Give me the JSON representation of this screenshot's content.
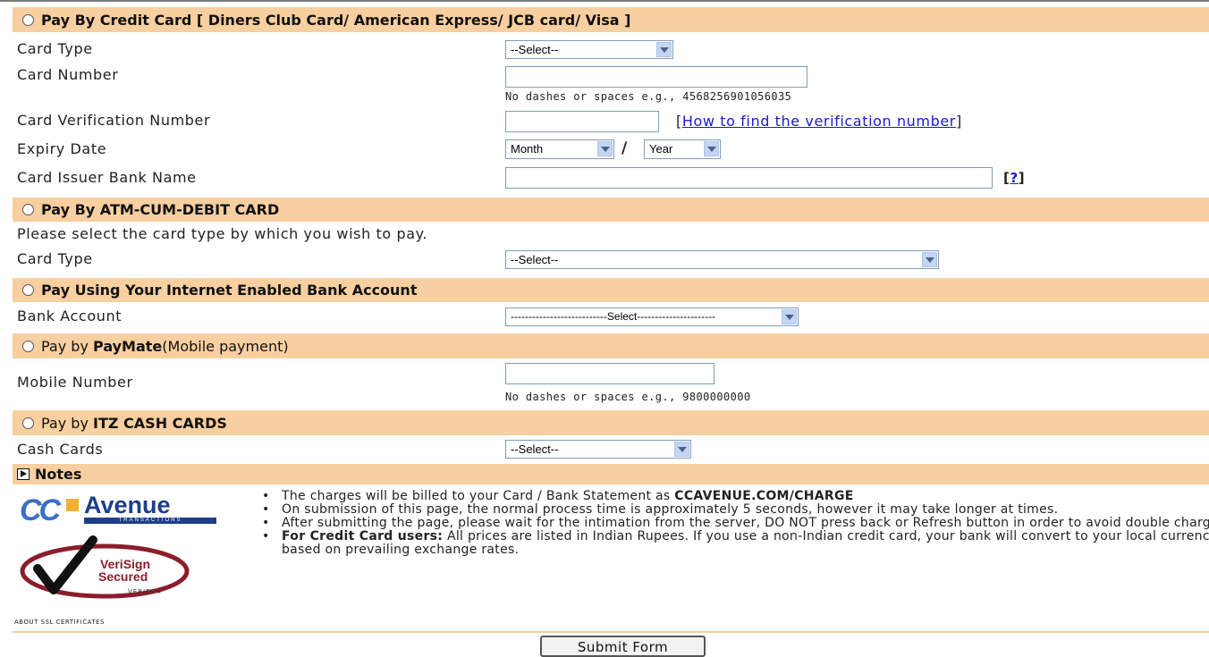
{
  "credit": {
    "label_pre": "Pay By Credit Card",
    "label_cards": "[ Diners Club Card/ American Express/ JCB card/ Visa ]",
    "card_type_label": "Card Type",
    "card_type_value": "--Select--",
    "card_number_label": "Card Number",
    "card_number_hint": "No dashes or spaces e.g., 4568256901056035",
    "cvv_label": "Card Verification Number",
    "cvv_link_open": "[",
    "cvv_link": "How to find the verification number",
    "cvv_link_close": "]",
    "expiry_label": "Expiry Date",
    "month_value": "Month",
    "slash": "/",
    "year_value": "Year",
    "issuer_label": "Card Issuer Bank Name",
    "issuer_help_open": "[",
    "issuer_help": "?",
    "issuer_help_close": "]"
  },
  "debit": {
    "label": "Pay By ATM-CUM-DEBIT CARD",
    "instruction": "Please select the card type by which you wish to pay.",
    "card_type_label": "Card Type",
    "card_type_value": "--Select--"
  },
  "netbank": {
    "label": "Pay Using Your Internet Enabled Bank Account",
    "account_label": "Bank Account",
    "account_value": "---------------------------Select----------------------"
  },
  "paymate": {
    "label_pre": "Pay by",
    "label_bold": "PayMate",
    "label_post": "(Mobile payment)",
    "mobile_label": "Mobile Number",
    "mobile_hint": "No dashes or spaces e.g., 9800000000"
  },
  "itz": {
    "label_pre": "Pay by",
    "label_bold": "ITZ CASH CARDS",
    "cash_label": "Cash Cards",
    "cash_value": "--Select--"
  },
  "notes": {
    "label": "Notes",
    "logo_cc": "CC",
    "logo_avenue": "Avenue",
    "logo_transactions": "TRANSACTIONS",
    "verisign_line1": "VeriSign",
    "verisign_line2": "Secured",
    "verisign_verify": "VERIFY ▸",
    "ssl_link": "ABOUT SSL CERTIFICATES",
    "items": [
      {
        "pre": "The charges will be billed to your Card / Bank Statement as ",
        "bold": "CCAVENUE.COM/CHARGE",
        "post": ""
      },
      {
        "pre": "",
        "bold": "",
        "post": "On submission of this page, the normal process time is approximately 5 seconds, however it may take longer at times."
      },
      {
        "pre": "",
        "bold": "",
        "post": "After submitting the page, please wait for the intimation from the server, DO NOT press back or Refresh button in order to avoid double charge."
      },
      {
        "pre": "",
        "bold": "For Credit Card users:",
        "post": " All prices are listed in Indian Rupees. If you use a non-Indian credit card, your bank will convert to your local currency based on prevailing exchange rates."
      }
    ]
  },
  "submit_label": "Submit Form",
  "colors": {
    "band": "#f8cfa0",
    "link": "#1a1ad0"
  }
}
